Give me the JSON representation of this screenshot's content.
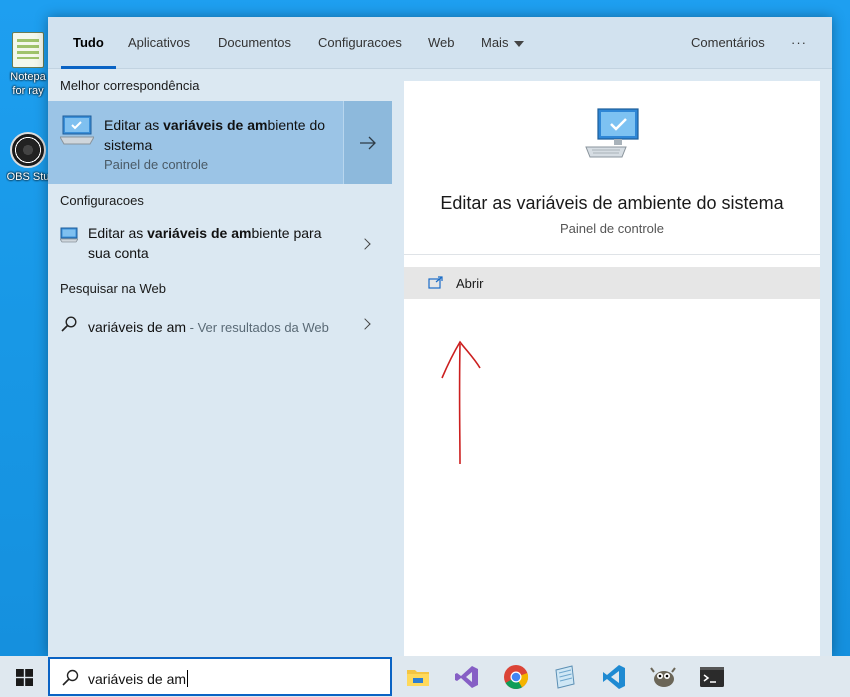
{
  "desktop": {
    "icons": [
      {
        "label_line1": "Notepa",
        "label_line2": "for ray"
      },
      {
        "label_line1": "OBS Stu"
      }
    ]
  },
  "tabs": {
    "all": "Tudo",
    "apps": "Aplicativos",
    "documents": "Documentos",
    "settings": "Configuracoes",
    "web": "Web",
    "more": "Mais",
    "feedback": "Comentários",
    "options": "···"
  },
  "results": {
    "best_match_header": "Melhor correspondência",
    "best_match": {
      "title_pre": "Editar as ",
      "title_bold1": "variáveis de am",
      "title_post": "biente do sistema",
      "subtitle": "Painel de controle"
    },
    "settings_header": "Configuracoes",
    "settings_item": {
      "title_pre": "Editar as ",
      "title_bold1": "variáveis de am",
      "title_post": "biente para sua conta"
    },
    "web_header": "Pesquisar na Web",
    "web_item": {
      "query": "variáveis de am",
      "suffix": " - Ver resultados da Web"
    }
  },
  "preview": {
    "title": "Editar as variáveis de ambiente do sistema",
    "subtitle": "Painel de controle",
    "action_open": "Abrir"
  },
  "taskbar": {
    "search_value": "variáveis de am",
    "apps": [
      "file-explorer-icon",
      "visual-studio-icon",
      "chrome-icon",
      "notepad-icon",
      "vscode-icon",
      "gimp-icon",
      "terminal-icon"
    ]
  },
  "colors": {
    "accent": "#0a63c4",
    "best_match_bg": "#9bc4e6",
    "annotation": "#cc1f1f"
  }
}
